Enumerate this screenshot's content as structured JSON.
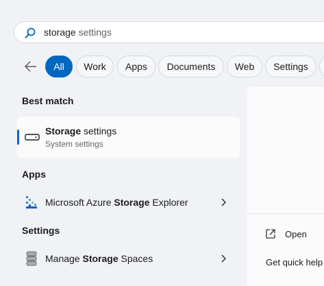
{
  "search": {
    "query_bold": "storage",
    "query_rest": " settings"
  },
  "filters": [
    "All",
    "Work",
    "Apps",
    "Documents",
    "Web",
    "Settings"
  ],
  "best_match": {
    "header": "Best match",
    "title_bold": "Storage",
    "title_rest": " settings",
    "subtitle": "System settings"
  },
  "apps": {
    "header": "Apps",
    "items": [
      {
        "pre": "Microsoft Azure ",
        "bold": "Storage",
        "post": " Explorer",
        "icon": "azure-storage-explorer-icon"
      }
    ]
  },
  "settings": {
    "header": "Settings",
    "items": [
      {
        "pre": "Manage ",
        "bold": "Storage",
        "post": " Spaces",
        "icon": "storage-spaces-icon"
      }
    ]
  },
  "preview": {
    "open_label": "Open",
    "help_label": "Get quick help f"
  },
  "colors": {
    "accent": "#0067c0",
    "background": "#f0f2f5"
  }
}
